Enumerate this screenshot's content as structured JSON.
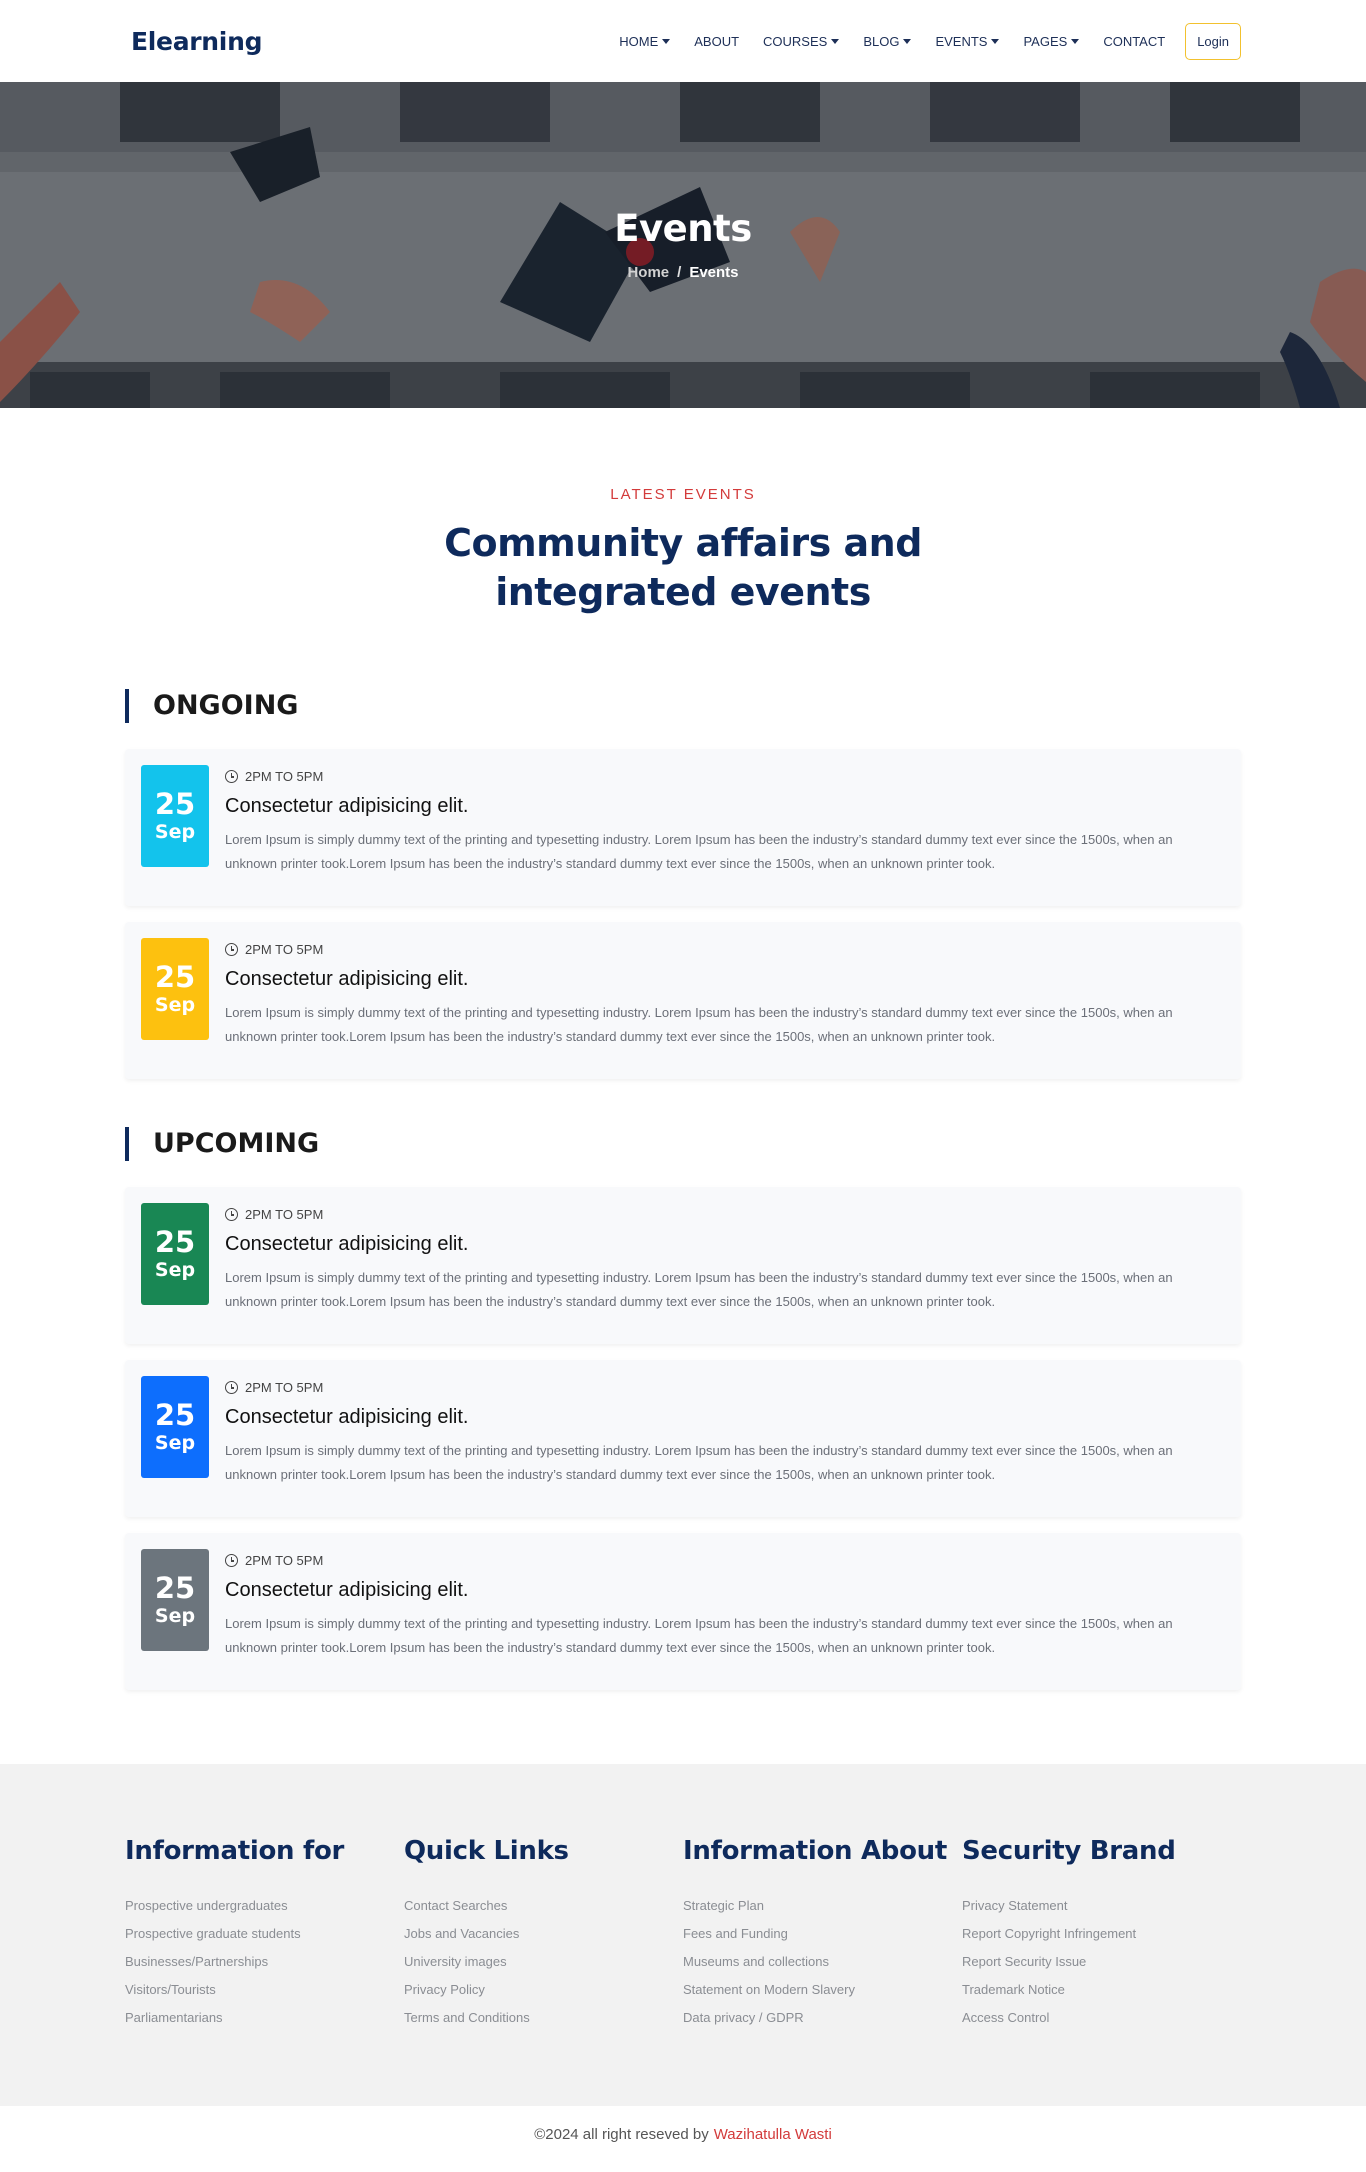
{
  "nav": {
    "brand": "Elearning",
    "items": [
      {
        "label": "HOME",
        "dropdown": true
      },
      {
        "label": "ABOUT",
        "dropdown": false
      },
      {
        "label": "COURSES",
        "dropdown": true
      },
      {
        "label": "BLOG",
        "dropdown": true
      },
      {
        "label": "EVENTS",
        "dropdown": true
      },
      {
        "label": "PAGES",
        "dropdown": true
      },
      {
        "label": "CONTACT",
        "dropdown": false
      }
    ],
    "login": "Login"
  },
  "hero": {
    "title": "Events",
    "breadcrumb": {
      "home": "Home",
      "separator": "/",
      "current": "Events"
    }
  },
  "section": {
    "eyebrow": "LATEST EVENTS",
    "title": "Community affairs and integrated events"
  },
  "groups": [
    {
      "heading": "ONGOING",
      "events": [
        {
          "day": "25",
          "month": "Sep",
          "color": "#13c3ec",
          "time": "2PM TO 5PM",
          "title": "Consectetur adipisicing elit.",
          "desc": "Lorem Ipsum is simply dummy text of the printing and typesetting industry. Lorem Ipsum has been the industry’s standard dummy text ever since the 1500s, when an unknown printer took.Lorem Ipsum has been the industry’s standard dummy text ever since the 1500s, when an unknown printer took."
        },
        {
          "day": "25",
          "month": "Sep",
          "color": "#fdc10f",
          "time": "2PM TO 5PM",
          "title": "Consectetur adipisicing elit.",
          "desc": "Lorem Ipsum is simply dummy text of the printing and typesetting industry. Lorem Ipsum has been the industry’s standard dummy text ever since the 1500s, when an unknown printer took.Lorem Ipsum has been the industry’s standard dummy text ever since the 1500s, when an unknown printer took."
        }
      ]
    },
    {
      "heading": "UPCOMING",
      "events": [
        {
          "day": "25",
          "month": "Sep",
          "color": "#198754",
          "time": "2PM TO 5PM",
          "title": "Consectetur adipisicing elit.",
          "desc": "Lorem Ipsum is simply dummy text of the printing and typesetting industry. Lorem Ipsum has been the industry’s standard dummy text ever since the 1500s, when an unknown printer took.Lorem Ipsum has been the industry’s standard dummy text ever since the 1500s, when an unknown printer took."
        },
        {
          "day": "25",
          "month": "Sep",
          "color": "#0d6efd",
          "time": "2PM TO 5PM",
          "title": "Consectetur adipisicing elit.",
          "desc": "Lorem Ipsum is simply dummy text of the printing and typesetting industry. Lorem Ipsum has been the industry’s standard dummy text ever since the 1500s, when an unknown printer took.Lorem Ipsum has been the industry’s standard dummy text ever since the 1500s, when an unknown printer took."
        },
        {
          "day": "25",
          "month": "Sep",
          "color": "#6c757d",
          "time": "2PM TO 5PM",
          "title": "Consectetur adipisicing elit.",
          "desc": "Lorem Ipsum is simply dummy text of the printing and typesetting industry. Lorem Ipsum has been the industry’s standard dummy text ever since the 1500s, when an unknown printer took.Lorem Ipsum has been the industry’s standard dummy text ever since the 1500s, when an unknown printer took."
        }
      ]
    }
  ],
  "footer": {
    "columns": [
      {
        "title": "Information for",
        "links": [
          "Prospective undergraduates",
          "Prospective graduate students",
          "Businesses/Partnerships",
          "Visitors/Tourists",
          "Parliamentarians"
        ]
      },
      {
        "title": "Quick Links",
        "links": [
          "Contact Searches",
          "Jobs and Vacancies",
          "University images",
          "Privacy Policy",
          "Terms and Conditions"
        ]
      },
      {
        "title": "Information About",
        "links": [
          "Strategic Plan",
          "Fees and Funding",
          "Museums and collections",
          "Statement on Modern Slavery",
          "Data privacy / GDPR"
        ]
      },
      {
        "title": "Security Brand",
        "links": [
          "Privacy Statement",
          "Report Copyright Infringement",
          "Report Security Issue",
          "Trademark Notice",
          "Access Control"
        ]
      }
    ],
    "copyright": "©2024 all right reseved by",
    "author": "Wazihatulla Wasti"
  }
}
